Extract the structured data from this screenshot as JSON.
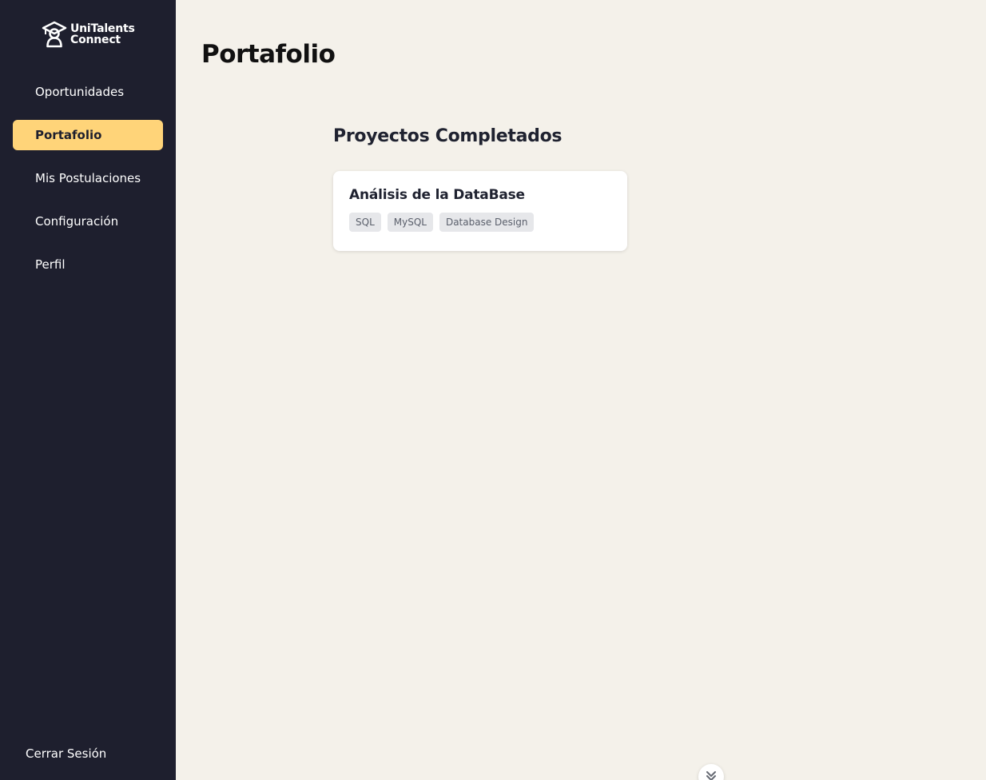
{
  "app": {
    "logo_line1": "UniTalents",
    "logo_line2": "Connect"
  },
  "sidebar": {
    "items": [
      {
        "label": "Oportunidades",
        "active": false
      },
      {
        "label": "Portafolio",
        "active": true
      },
      {
        "label": "Mis Postulaciones",
        "active": false
      },
      {
        "label": "Configuración",
        "active": false
      },
      {
        "label": "Perfil",
        "active": false
      }
    ],
    "logout_label": "Cerrar Sesión"
  },
  "main": {
    "page_title": "Portafolio",
    "section_title": "Proyectos Completados",
    "projects": [
      {
        "title": "Análisis de la DataBase",
        "tags": [
          "SQL",
          "MySQL",
          "Database Design"
        ]
      }
    ]
  },
  "colors": {
    "sidebar_bg": "#1e1f2e",
    "accent": "#ffd479",
    "page_bg": "#f4f1ea"
  },
  "icons": {
    "logo": "graduate-person-icon",
    "scroll": "chevron-down-icon"
  }
}
